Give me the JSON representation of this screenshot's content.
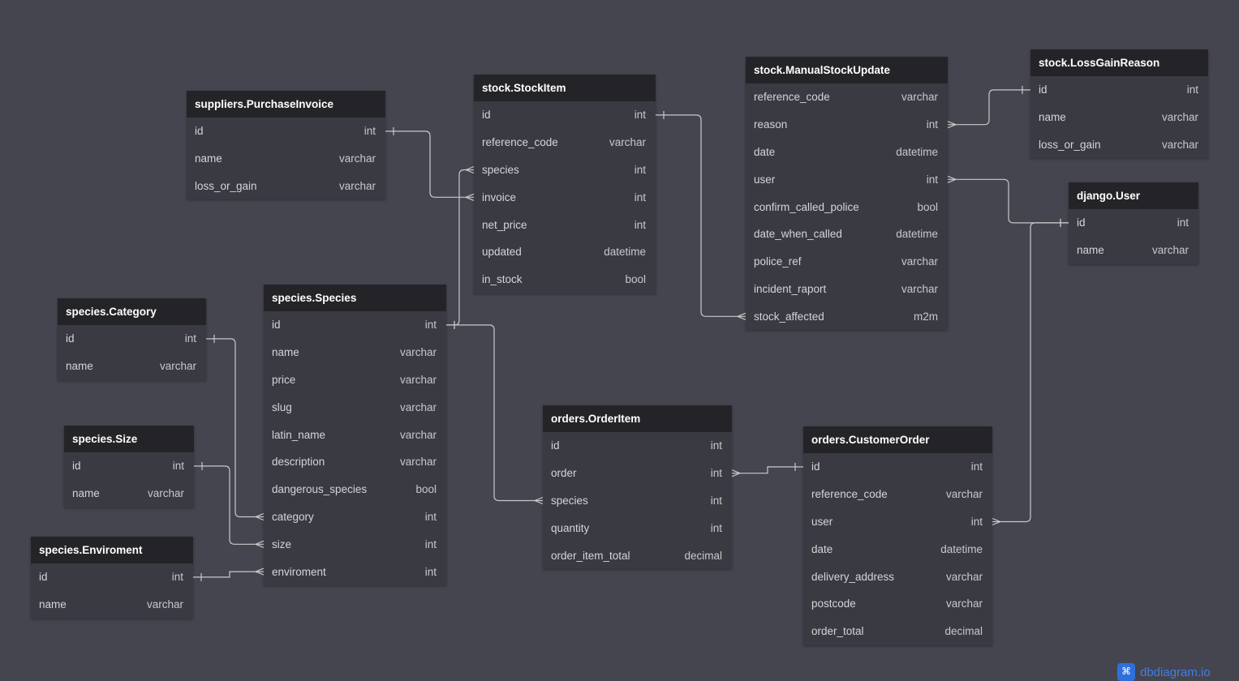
{
  "tables": [
    {
      "key": "purchase_invoice",
      "name": "suppliers.PurchaseInvoice",
      "fields": [
        [
          "id",
          "int"
        ],
        [
          "name",
          "varchar"
        ],
        [
          "loss_or_gain",
          "varchar"
        ]
      ]
    },
    {
      "key": "stock_item",
      "name": "stock.StockItem",
      "fields": [
        [
          "id",
          "int"
        ],
        [
          "reference_code",
          "varchar"
        ],
        [
          "species",
          "int"
        ],
        [
          "invoice",
          "int"
        ],
        [
          "net_price",
          "int"
        ],
        [
          "updated",
          "datetime"
        ],
        [
          "in_stock",
          "bool"
        ]
      ]
    },
    {
      "key": "manual_stock_update",
      "name": "stock.ManualStockUpdate",
      "fields": [
        [
          "reference_code",
          "varchar"
        ],
        [
          "reason",
          "int"
        ],
        [
          "date",
          "datetime"
        ],
        [
          "user",
          "int"
        ],
        [
          "confirm_called_police",
          "bool"
        ],
        [
          "date_when_called",
          "datetime"
        ],
        [
          "police_ref",
          "varchar"
        ],
        [
          "incident_raport",
          "varchar"
        ],
        [
          "stock_affected",
          "m2m"
        ]
      ]
    },
    {
      "key": "loss_gain_reason",
      "name": "stock.LossGainReason",
      "fields": [
        [
          "id",
          "int"
        ],
        [
          "name",
          "varchar"
        ],
        [
          "loss_or_gain",
          "varchar"
        ]
      ]
    },
    {
      "key": "django_user",
      "name": "django.User",
      "fields": [
        [
          "id",
          "int"
        ],
        [
          "name",
          "varchar"
        ]
      ]
    },
    {
      "key": "species_category",
      "name": "species.Category",
      "fields": [
        [
          "id",
          "int"
        ],
        [
          "name",
          "varchar"
        ]
      ]
    },
    {
      "key": "species_species",
      "name": "species.Species",
      "fields": [
        [
          "id",
          "int"
        ],
        [
          "name",
          "varchar"
        ],
        [
          "price",
          "varchar"
        ],
        [
          "slug",
          "varchar"
        ],
        [
          "latin_name",
          "varchar"
        ],
        [
          "description",
          "varchar"
        ],
        [
          "dangerous_species",
          "bool"
        ],
        [
          "category",
          "int"
        ],
        [
          "size",
          "int"
        ],
        [
          "enviroment",
          "int"
        ]
      ]
    },
    {
      "key": "species_size",
      "name": "species.Size",
      "fields": [
        [
          "id",
          "int"
        ],
        [
          "name",
          "varchar"
        ]
      ]
    },
    {
      "key": "species_enviroment",
      "name": "species.Enviroment",
      "fields": [
        [
          "id",
          "int"
        ],
        [
          "name",
          "varchar"
        ]
      ]
    },
    {
      "key": "order_item",
      "name": "orders.OrderItem",
      "fields": [
        [
          "id",
          "int"
        ],
        [
          "order",
          "int"
        ],
        [
          "species",
          "int"
        ],
        [
          "quantity",
          "int"
        ],
        [
          "order_item_total",
          "decimal"
        ]
      ]
    },
    {
      "key": "customer_order",
      "name": "orders.CustomerOrder",
      "fields": [
        [
          "id",
          "int"
        ],
        [
          "reference_code",
          "varchar"
        ],
        [
          "user",
          "int"
        ],
        [
          "date",
          "datetime"
        ],
        [
          "delivery_address",
          "varchar"
        ],
        [
          "postcode",
          "varchar"
        ],
        [
          "order_total",
          "decimal"
        ]
      ]
    }
  ],
  "relationships": [
    {
      "from": "purchase_invoice.id",
      "to": "stock_item.invoice",
      "type": "one-to-many"
    },
    {
      "from": "species_species.id",
      "to": "stock_item.species",
      "type": "one-to-many"
    },
    {
      "from": "stock_item.id",
      "to": "manual_stock_update.stock_affected",
      "type": "one-to-many"
    },
    {
      "from": "loss_gain_reason.id",
      "to": "manual_stock_update.reason",
      "type": "one-to-many"
    },
    {
      "from": "django_user.id",
      "to": "manual_stock_update.user",
      "type": "one-to-many"
    },
    {
      "from": "django_user.id",
      "to": "customer_order.user",
      "type": "one-to-many"
    },
    {
      "from": "species_category.id",
      "to": "species_species.category",
      "type": "one-to-many"
    },
    {
      "from": "species_size.id",
      "to": "species_species.size",
      "type": "one-to-many"
    },
    {
      "from": "species_enviroment.id",
      "to": "species_species.enviroment",
      "type": "one-to-many"
    },
    {
      "from": "species_species.id",
      "to": "order_item.species",
      "type": "one-to-many"
    },
    {
      "from": "customer_order.id",
      "to": "order_item.order",
      "type": "one-to-many"
    }
  ],
  "brand": {
    "name": "dbdiagram.io"
  },
  "colors": {
    "background": "#454550",
    "table_header": "#242428",
    "table_body": "#3a3a42",
    "connector": "#c8c8c8",
    "brand": "#3f7ee8"
  }
}
